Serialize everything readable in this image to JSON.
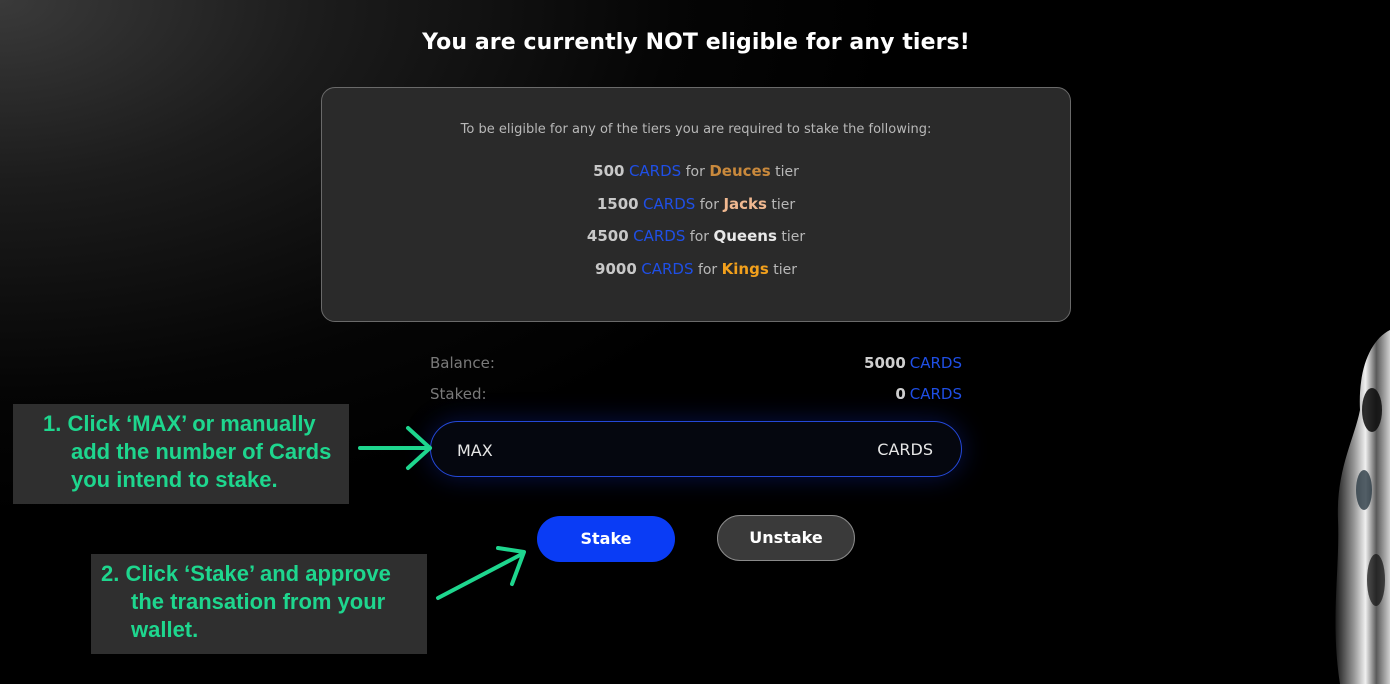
{
  "heading": "You are currently NOT eligible for any tiers!",
  "tiers": {
    "intro": "To be eligible for any of the tiers you are required to stake the following:",
    "token": "CARDS",
    "for_word": "for",
    "tier_word": "tier",
    "rows": [
      {
        "amount": "500",
        "name": "Deuces",
        "color": "#c9893c"
      },
      {
        "amount": "1500",
        "name": "Jacks",
        "color": "#f0b890"
      },
      {
        "amount": "4500",
        "name": "Queens",
        "color": "#e8e8e8"
      },
      {
        "amount": "9000",
        "name": "Kings",
        "color": "#f2a01c"
      }
    ]
  },
  "balance": {
    "label": "Balance:",
    "value": "5000",
    "token": "CARDS"
  },
  "staked": {
    "label": "Staked:",
    "value": "0",
    "token": "CARDS"
  },
  "stake_input": {
    "placeholder": "MAX",
    "unit": "CARDS"
  },
  "buttons": {
    "stake": "Stake",
    "unstake": "Unstake"
  },
  "callouts": {
    "step1": {
      "num": "1.",
      "first": "Click ‘MAX’ or manually",
      "second": "add the number of Cards",
      "third": "you intend to stake."
    },
    "step2": {
      "num": "2.",
      "first": "Click ‘Stake’ and approve",
      "second": "the transation from your",
      "third": "wallet."
    }
  },
  "colors": {
    "accent_blue": "#0a3cf5",
    "token_blue": "#1f4fe6",
    "callout_green": "#1ed68e"
  }
}
